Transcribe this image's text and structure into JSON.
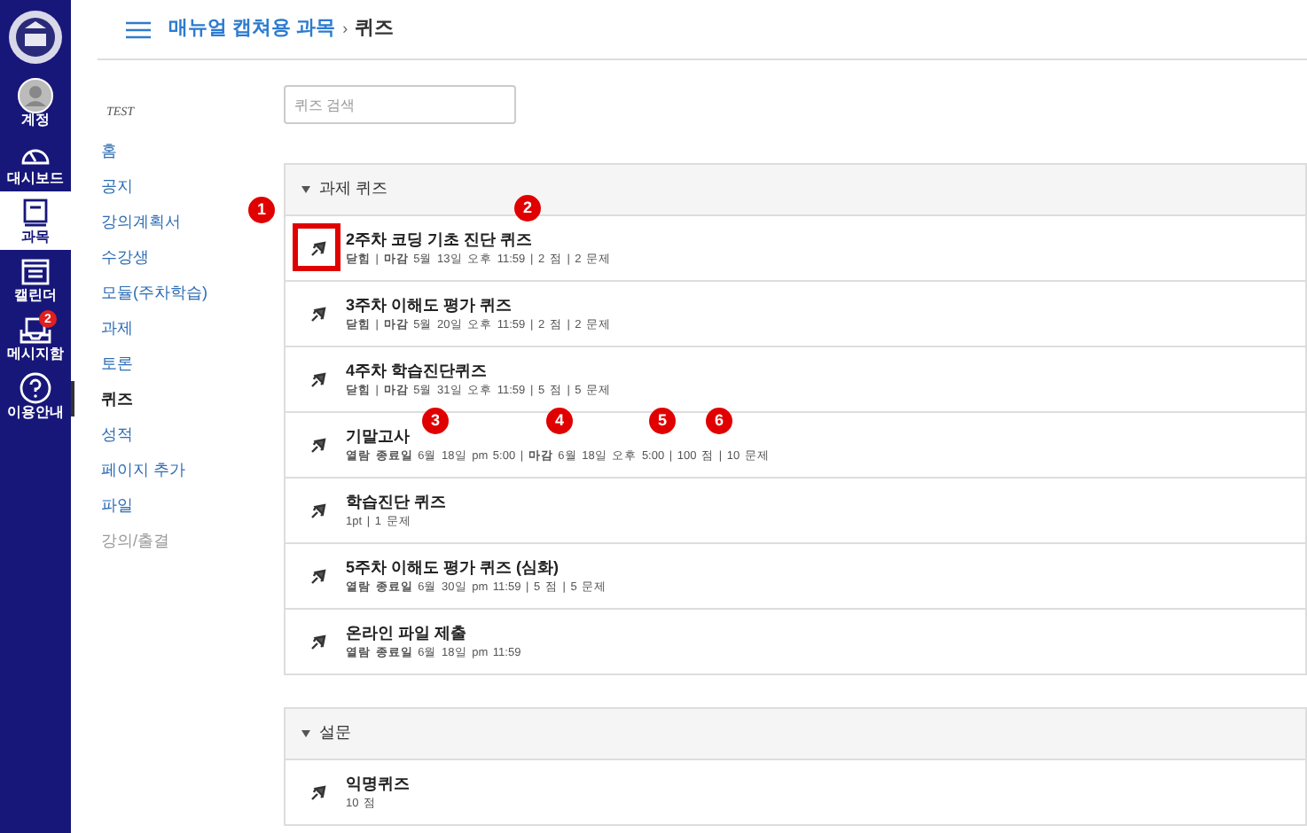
{
  "global_nav": [
    {
      "label": "계정",
      "kind": "account",
      "selected": false
    },
    {
      "label": "대시보드",
      "kind": "dashboard",
      "selected": false
    },
    {
      "label": "과목",
      "kind": "courses",
      "selected": true
    },
    {
      "label": "캘린더",
      "kind": "calendar",
      "selected": false
    },
    {
      "label": "메시지함",
      "kind": "inbox",
      "selected": false,
      "badge": "2"
    },
    {
      "label": "이용안내",
      "kind": "help",
      "selected": false
    }
  ],
  "breadcrumb": {
    "course": "매뉴얼 캡쳐용 과목",
    "separator": "›",
    "page": "퀴즈"
  },
  "course_nav": {
    "term": "TEST",
    "items": [
      {
        "label": "홈",
        "selected": false,
        "disabled": false
      },
      {
        "label": "공지",
        "selected": false,
        "disabled": false
      },
      {
        "label": "강의계획서",
        "selected": false,
        "disabled": false
      },
      {
        "label": "수강생",
        "selected": false,
        "disabled": false
      },
      {
        "label": "모듈(주차학습)",
        "selected": false,
        "disabled": false
      },
      {
        "label": "과제",
        "selected": false,
        "disabled": false
      },
      {
        "label": "토론",
        "selected": false,
        "disabled": false
      },
      {
        "label": "퀴즈",
        "selected": true,
        "disabled": false
      },
      {
        "label": "성적",
        "selected": false,
        "disabled": false
      },
      {
        "label": "페이지 추가",
        "selected": false,
        "disabled": false
      },
      {
        "label": "파일",
        "selected": false,
        "disabled": false
      },
      {
        "label": "강의/출결",
        "selected": false,
        "disabled": true
      }
    ]
  },
  "search": {
    "placeholder": "퀴즈 검색"
  },
  "sections": [
    {
      "title": "과제 퀴즈",
      "expanded": true,
      "quizzes": [
        {
          "title": "2주차 코딩 기초 진단 퀴즈",
          "meta": "**닫힘** | **마감** 5월 13일 오후 11:59 | 2 점 | 2 문제",
          "highlighted": true
        },
        {
          "title": "3주차 이해도 평가 퀴즈",
          "meta": "**닫힘** | **마감** 5월 20일 오후 11:59 | 2 점 | 2 문제",
          "highlighted": false
        },
        {
          "title": "4주차 학습진단퀴즈",
          "meta": "**닫힘** | **마감** 5월 31일 오후 11:59 | 5 점 | 5 문제",
          "highlighted": false
        },
        {
          "title": "기말고사",
          "meta": "**열람 종료일** 6월 18일 pm 5:00 | **마감** 6월 18일 오후 5:00 | 100 점 | 10 문제",
          "highlighted": false
        },
        {
          "title": "학습진단 퀴즈",
          "meta": "1pt | 1 문제",
          "highlighted": false
        },
        {
          "title": "5주차 이해도 평가 퀴즈 (심화)",
          "meta": "**열람 종료일** 6월 30일 pm 11:59 | 5 점 | 5 문제",
          "highlighted": false
        },
        {
          "title": "온라인 파일 제출",
          "meta": "**열람 종료일** 6월 18일 pm 11:59",
          "highlighted": false
        }
      ]
    },
    {
      "title": "설문",
      "expanded": true,
      "quizzes": [
        {
          "title": "익명퀴즈",
          "meta": "10 점",
          "highlighted": false
        }
      ]
    }
  ],
  "callouts": [
    "1",
    "2",
    "3",
    "4",
    "5",
    "6"
  ]
}
